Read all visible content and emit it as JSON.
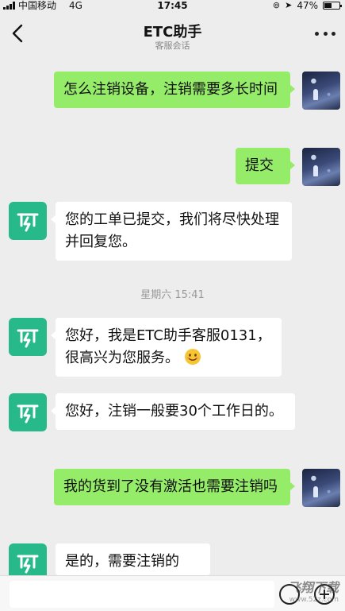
{
  "status": {
    "carrier": "中国移动",
    "network": "4G",
    "time": "17:45",
    "battery": "47%"
  },
  "header": {
    "title": "ETC助手",
    "subtitle": "客服会话"
  },
  "messages": {
    "m1": "怎么注销设备，注销需要多长时间",
    "m2": "提交",
    "m3": "您的工单已提交，我们将尽快处理并回复您。",
    "ts": "星期六 15:41",
    "m4": "您好，我是ETC助手客服0131，很高兴为您服务。",
    "m5": "您好，注销一般要30个工作日的。",
    "m6": "我的货到了没有激活也需要注销吗",
    "m7": "是的，需要注销的"
  },
  "watermark": {
    "main": "飞翔下载",
    "url": "www.52z.com"
  },
  "icons": {
    "back": "chevron-left-icon",
    "more": "more-dots-icon",
    "emoji": "smile-emoji-icon",
    "plus": "plus-circle-icon"
  }
}
